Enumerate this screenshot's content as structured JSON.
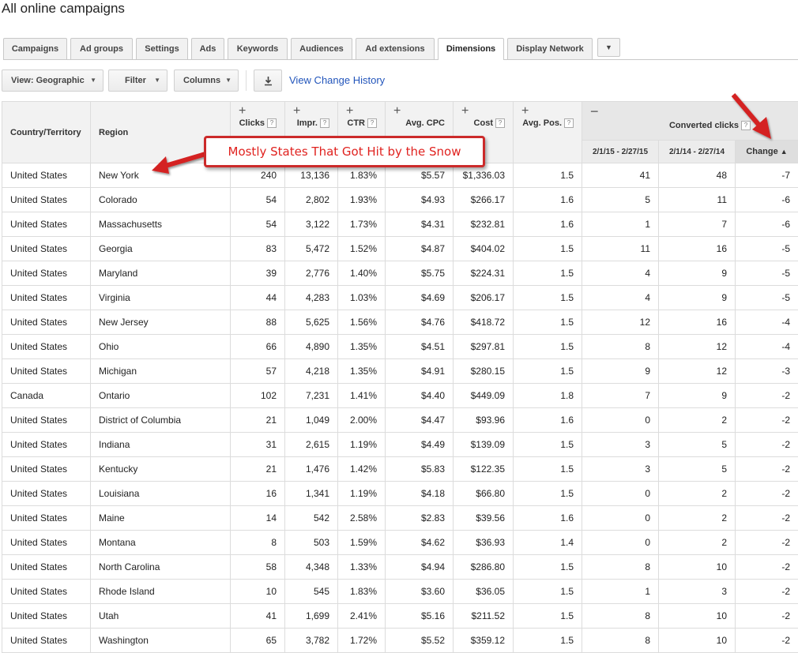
{
  "page": {
    "title": "All online campaigns"
  },
  "tabs": [
    {
      "label": "Campaigns"
    },
    {
      "label": "Ad groups"
    },
    {
      "label": "Settings"
    },
    {
      "label": "Ads"
    },
    {
      "label": "Keywords"
    },
    {
      "label": "Audiences"
    },
    {
      "label": "Ad extensions"
    },
    {
      "label": "Dimensions"
    },
    {
      "label": "Display Network"
    }
  ],
  "active_tab": "Dimensions",
  "toolbar": {
    "view_label": "View: Geographic",
    "filter_label": "Filter",
    "columns_label": "Columns",
    "history_link": "View Change History"
  },
  "table": {
    "headers": {
      "country": "Country/Territory",
      "region": "Region",
      "clicks": "Clicks",
      "impr": "Impr.",
      "ctr": "CTR",
      "cpc": "Avg. CPC",
      "cost": "Cost",
      "pos": "Avg. Pos.",
      "group": "Converted clicks",
      "period1": "2/1/15 - 2/27/15",
      "period2": "2/1/14 - 2/27/14",
      "change": "Change"
    },
    "rows": [
      {
        "country": "United States",
        "region": "New York",
        "clicks": "240",
        "impr": "13,136",
        "ctr": "1.83%",
        "cpc": "$5.57",
        "cost": "$1,336.03",
        "pos": "1.5",
        "p1": "41",
        "p2": "48",
        "change": "-7"
      },
      {
        "country": "United States",
        "region": "Colorado",
        "clicks": "54",
        "impr": "2,802",
        "ctr": "1.93%",
        "cpc": "$4.93",
        "cost": "$266.17",
        "pos": "1.6",
        "p1": "5",
        "p2": "11",
        "change": "-6"
      },
      {
        "country": "United States",
        "region": "Massachusetts",
        "clicks": "54",
        "impr": "3,122",
        "ctr": "1.73%",
        "cpc": "$4.31",
        "cost": "$232.81",
        "pos": "1.6",
        "p1": "1",
        "p2": "7",
        "change": "-6"
      },
      {
        "country": "United States",
        "region": "Georgia",
        "clicks": "83",
        "impr": "5,472",
        "ctr": "1.52%",
        "cpc": "$4.87",
        "cost": "$404.02",
        "pos": "1.5",
        "p1": "11",
        "p2": "16",
        "change": "-5"
      },
      {
        "country": "United States",
        "region": "Maryland",
        "clicks": "39",
        "impr": "2,776",
        "ctr": "1.40%",
        "cpc": "$5.75",
        "cost": "$224.31",
        "pos": "1.5",
        "p1": "4",
        "p2": "9",
        "change": "-5"
      },
      {
        "country": "United States",
        "region": "Virginia",
        "clicks": "44",
        "impr": "4,283",
        "ctr": "1.03%",
        "cpc": "$4.69",
        "cost": "$206.17",
        "pos": "1.5",
        "p1": "4",
        "p2": "9",
        "change": "-5"
      },
      {
        "country": "United States",
        "region": "New Jersey",
        "clicks": "88",
        "impr": "5,625",
        "ctr": "1.56%",
        "cpc": "$4.76",
        "cost": "$418.72",
        "pos": "1.5",
        "p1": "12",
        "p2": "16",
        "change": "-4"
      },
      {
        "country": "United States",
        "region": "Ohio",
        "clicks": "66",
        "impr": "4,890",
        "ctr": "1.35%",
        "cpc": "$4.51",
        "cost": "$297.81",
        "pos": "1.5",
        "p1": "8",
        "p2": "12",
        "change": "-4"
      },
      {
        "country": "United States",
        "region": "Michigan",
        "clicks": "57",
        "impr": "4,218",
        "ctr": "1.35%",
        "cpc": "$4.91",
        "cost": "$280.15",
        "pos": "1.5",
        "p1": "9",
        "p2": "12",
        "change": "-3"
      },
      {
        "country": "Canada",
        "region": "Ontario",
        "clicks": "102",
        "impr": "7,231",
        "ctr": "1.41%",
        "cpc": "$4.40",
        "cost": "$449.09",
        "pos": "1.8",
        "p1": "7",
        "p2": "9",
        "change": "-2"
      },
      {
        "country": "United States",
        "region": "District of Columbia",
        "clicks": "21",
        "impr": "1,049",
        "ctr": "2.00%",
        "cpc": "$4.47",
        "cost": "$93.96",
        "pos": "1.6",
        "p1": "0",
        "p2": "2",
        "change": "-2"
      },
      {
        "country": "United States",
        "region": "Indiana",
        "clicks": "31",
        "impr": "2,615",
        "ctr": "1.19%",
        "cpc": "$4.49",
        "cost": "$139.09",
        "pos": "1.5",
        "p1": "3",
        "p2": "5",
        "change": "-2"
      },
      {
        "country": "United States",
        "region": "Kentucky",
        "clicks": "21",
        "impr": "1,476",
        "ctr": "1.42%",
        "cpc": "$5.83",
        "cost": "$122.35",
        "pos": "1.5",
        "p1": "3",
        "p2": "5",
        "change": "-2"
      },
      {
        "country": "United States",
        "region": "Louisiana",
        "clicks": "16",
        "impr": "1,341",
        "ctr": "1.19%",
        "cpc": "$4.18",
        "cost": "$66.80",
        "pos": "1.5",
        "p1": "0",
        "p2": "2",
        "change": "-2"
      },
      {
        "country": "United States",
        "region": "Maine",
        "clicks": "14",
        "impr": "542",
        "ctr": "2.58%",
        "cpc": "$2.83",
        "cost": "$39.56",
        "pos": "1.6",
        "p1": "0",
        "p2": "2",
        "change": "-2"
      },
      {
        "country": "United States",
        "region": "Montana",
        "clicks": "8",
        "impr": "503",
        "ctr": "1.59%",
        "cpc": "$4.62",
        "cost": "$36.93",
        "pos": "1.4",
        "p1": "0",
        "p2": "2",
        "change": "-2"
      },
      {
        "country": "United States",
        "region": "North Carolina",
        "clicks": "58",
        "impr": "4,348",
        "ctr": "1.33%",
        "cpc": "$4.94",
        "cost": "$286.80",
        "pos": "1.5",
        "p1": "8",
        "p2": "10",
        "change": "-2"
      },
      {
        "country": "United States",
        "region": "Rhode Island",
        "clicks": "10",
        "impr": "545",
        "ctr": "1.83%",
        "cpc": "$3.60",
        "cost": "$36.05",
        "pos": "1.5",
        "p1": "1",
        "p2": "3",
        "change": "-2"
      },
      {
        "country": "United States",
        "region": "Utah",
        "clicks": "41",
        "impr": "1,699",
        "ctr": "2.41%",
        "cpc": "$5.16",
        "cost": "$211.52",
        "pos": "1.5",
        "p1": "8",
        "p2": "10",
        "change": "-2"
      },
      {
        "country": "United States",
        "region": "Washington",
        "clicks": "65",
        "impr": "3,782",
        "ctr": "1.72%",
        "cpc": "$5.52",
        "cost": "$359.12",
        "pos": "1.5",
        "p1": "8",
        "p2": "10",
        "change": "-2"
      }
    ]
  },
  "annotation": {
    "text": "Mostly States That Got Hit by the Snow",
    "color": "#e0221f"
  },
  "icons": {
    "sort": "sort-ascending-icon",
    "download": "download-icon",
    "help": "help-icon"
  }
}
